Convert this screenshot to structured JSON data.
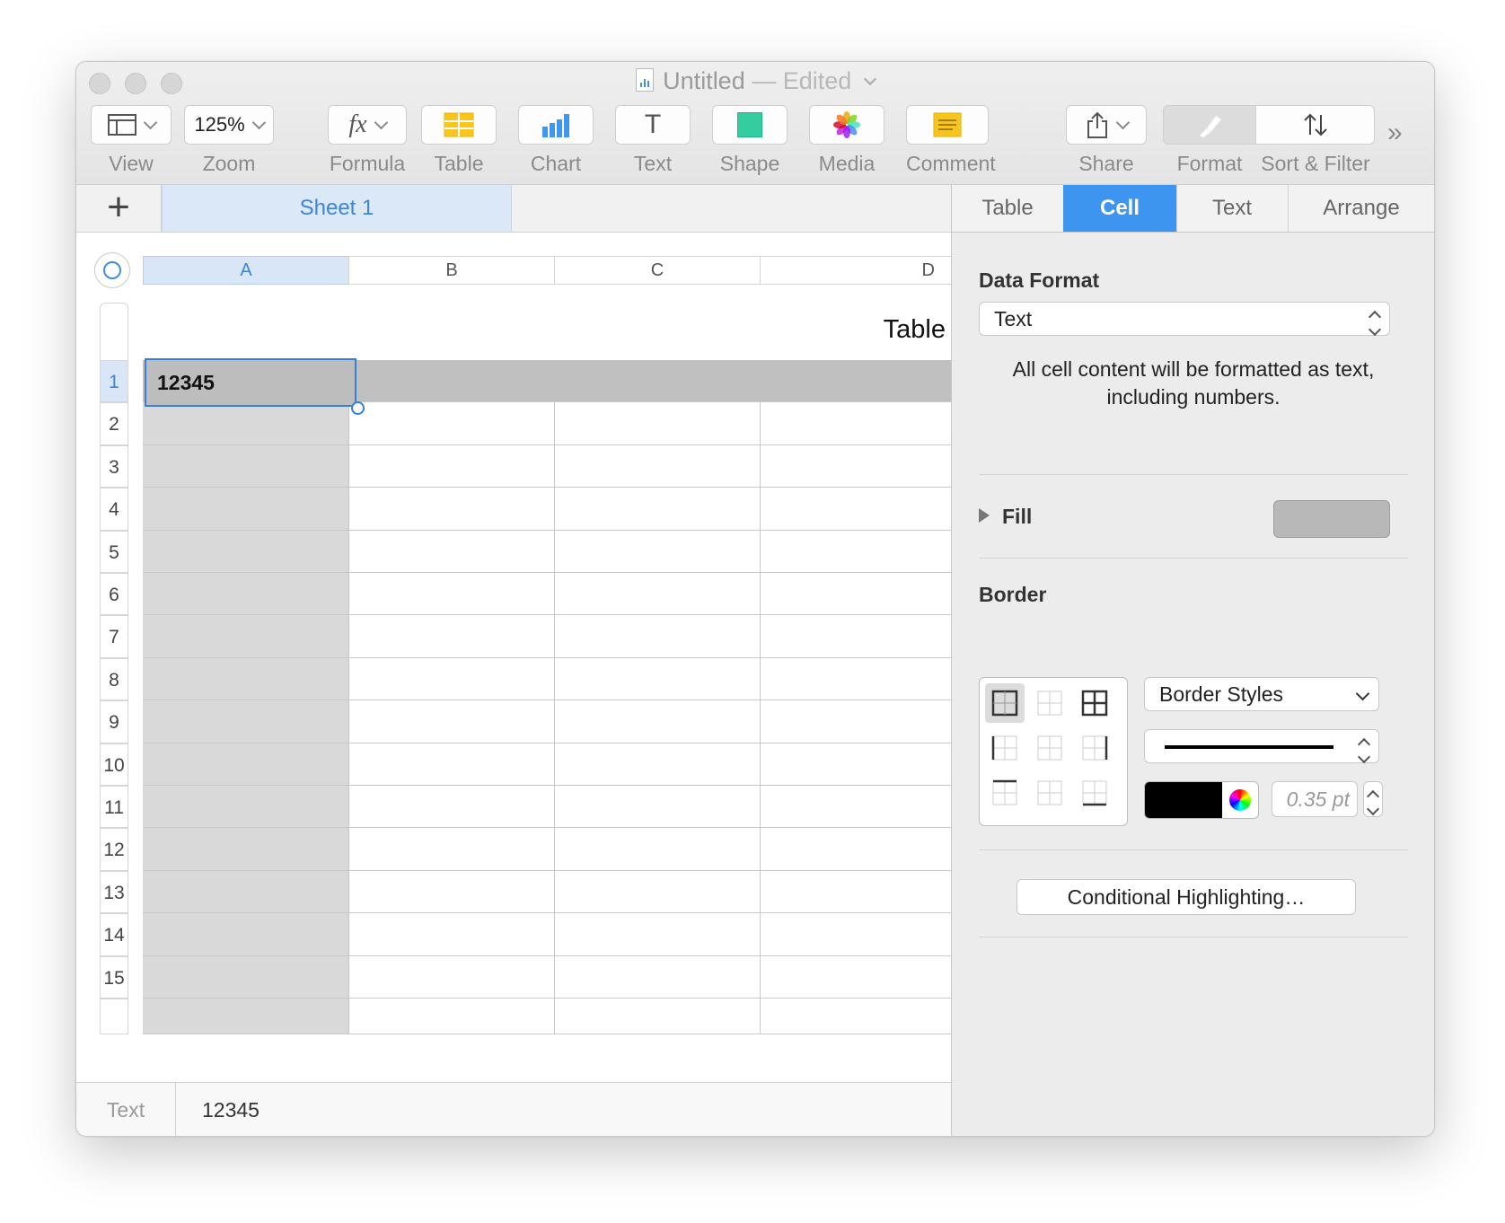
{
  "window": {
    "title": "Untitled",
    "title_suffix": "— Edited"
  },
  "toolbar": {
    "view": "View",
    "zoom_value": "125%",
    "zoom": "Zoom",
    "formula": "Formula",
    "formula_glyph": "fx",
    "table": "Table",
    "chart": "Chart",
    "text": "Text",
    "text_glyph": "T",
    "shape": "Shape",
    "media": "Media",
    "comment": "Comment",
    "share": "Share",
    "format": "Format",
    "sort_filter": "Sort & Filter",
    "more": "»"
  },
  "sheets": {
    "add": "+",
    "tabs": [
      "Sheet 1"
    ]
  },
  "table": {
    "title": "Table",
    "columns": [
      "A",
      "B",
      "C",
      "D"
    ],
    "rows": [
      "1",
      "2",
      "3",
      "4",
      "5",
      "6",
      "7",
      "8",
      "9",
      "10",
      "11",
      "12",
      "13",
      "14",
      "15"
    ],
    "active_cell_value": "12345"
  },
  "formula_bar": {
    "label": "Text",
    "value": "12345"
  },
  "inspector": {
    "tabs": [
      "Table",
      "Cell",
      "Text",
      "Arrange"
    ],
    "active_tab": "Cell",
    "data_format_title": "Data Format",
    "data_format_value": "Text",
    "data_format_desc_1": "All cell content will be formatted as text,",
    "data_format_desc_2": "including numbers.",
    "fill_title": "Fill",
    "fill_color": "#b8b8b8",
    "border_title": "Border",
    "border_styles": "Border Styles",
    "border_width": "0.35 pt",
    "border_color": "#000000",
    "conditional": "Conditional Highlighting…"
  },
  "colors": {
    "accent": "#3d95f0",
    "header_row_fill": "#c0c0c0",
    "header_col_fill": "#d9d9d9"
  }
}
